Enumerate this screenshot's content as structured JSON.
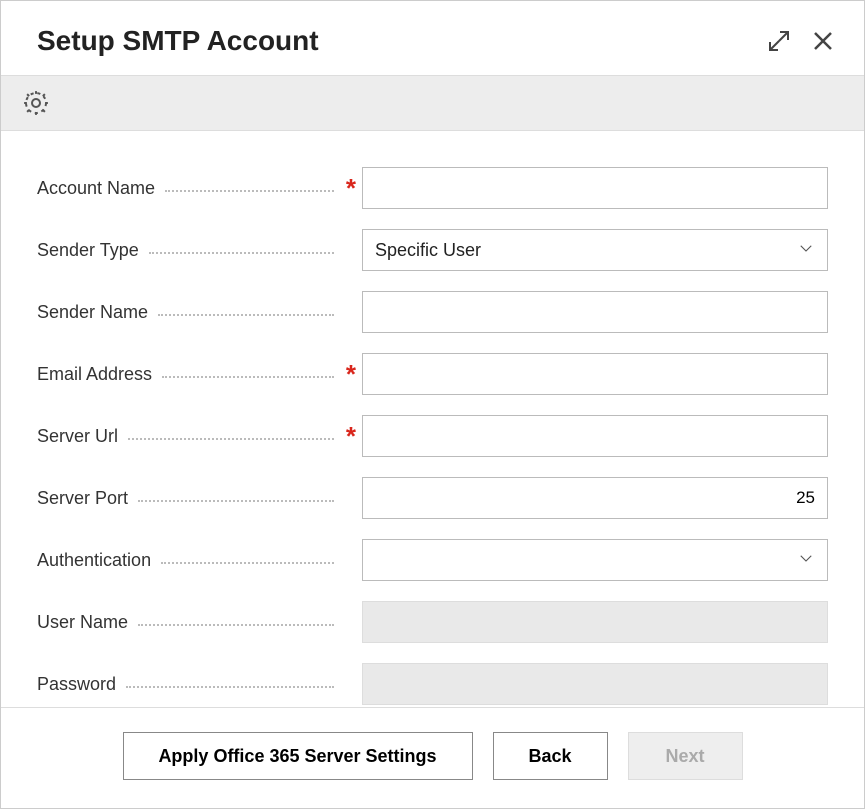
{
  "header": {
    "title": "Setup SMTP Account"
  },
  "form": {
    "account_name": {
      "label": "Account Name",
      "required": true,
      "value": ""
    },
    "sender_type": {
      "label": "Sender Type",
      "value": "Specific User"
    },
    "sender_name": {
      "label": "Sender Name",
      "value": ""
    },
    "email_address": {
      "label": "Email Address",
      "required": true,
      "value": ""
    },
    "server_url": {
      "label": "Server Url",
      "required": true,
      "value": ""
    },
    "server_port": {
      "label": "Server Port",
      "value": "25"
    },
    "authentication": {
      "label": "Authentication",
      "value": ""
    },
    "user_name": {
      "label": "User Name",
      "value": ""
    },
    "password": {
      "label": "Password",
      "value": ""
    }
  },
  "footer": {
    "apply_o365": "Apply Office 365 Server Settings",
    "back": "Back",
    "next": "Next"
  }
}
